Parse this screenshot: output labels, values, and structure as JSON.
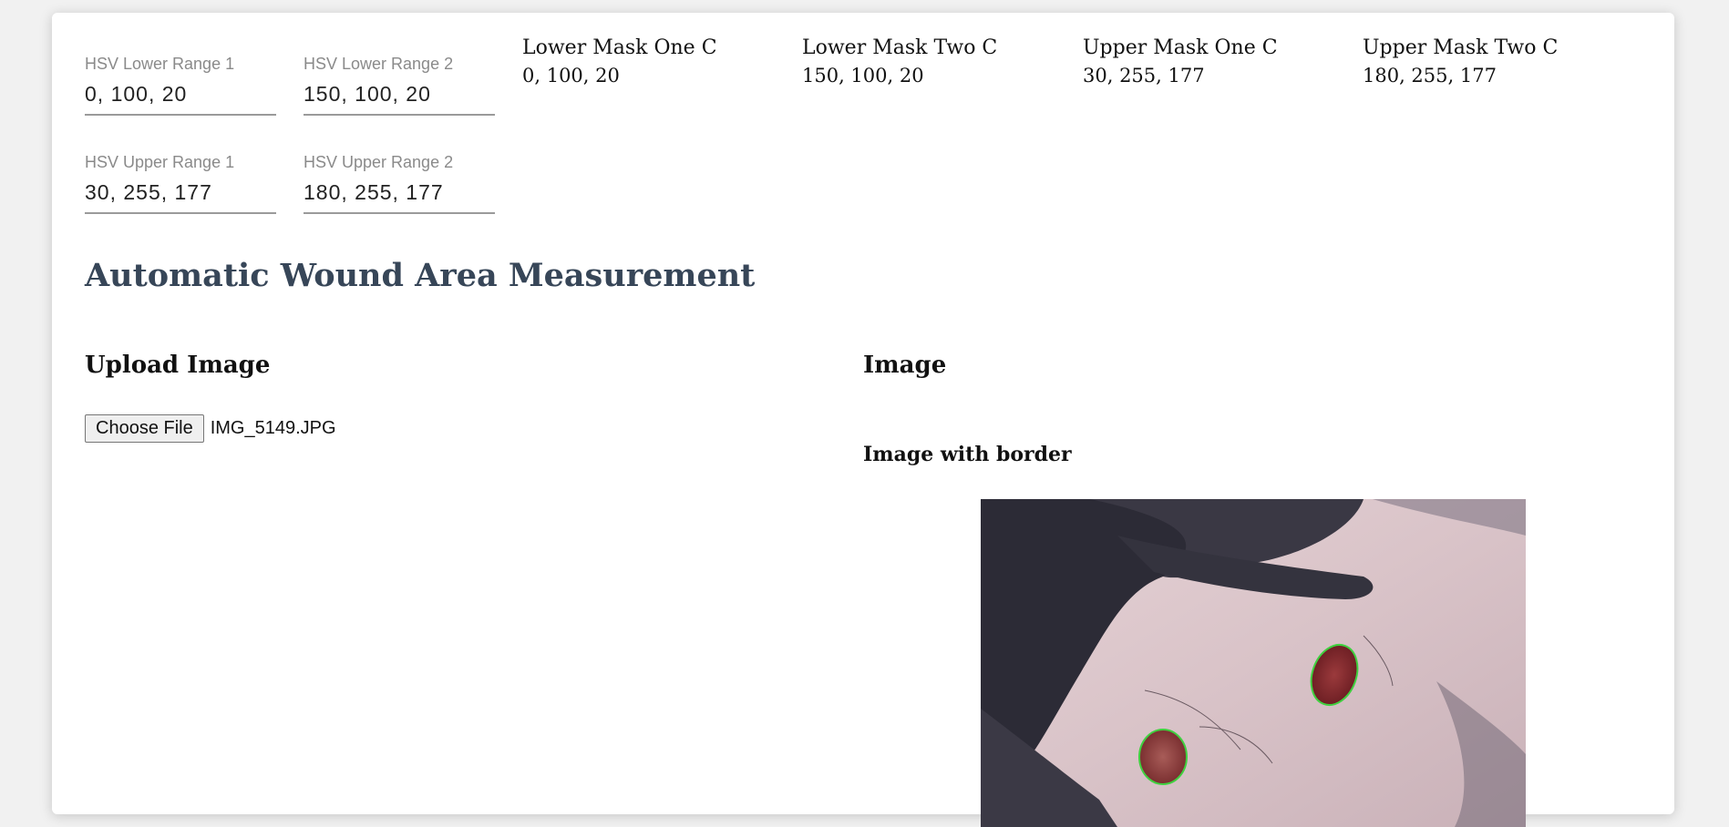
{
  "hsv_inputs": {
    "lower1": {
      "label": "HSV Lower Range 1",
      "value": "0, 100, 20"
    },
    "lower2": {
      "label": "HSV Lower Range 2",
      "value": "150, 100, 20"
    },
    "upper1": {
      "label": "HSV Upper Range 1",
      "value": "30, 255, 177"
    },
    "upper2": {
      "label": "HSV Upper Range 2",
      "value": "180, 255, 177"
    }
  },
  "masks": [
    {
      "title": "Lower Mask One C",
      "value": "0, 100, 20"
    },
    {
      "title": "Lower Mask Two C",
      "value": "150, 100, 20"
    },
    {
      "title": "Upper Mask One C",
      "value": "30, 255, 177"
    },
    {
      "title": "Upper Mask Two C",
      "value": "180, 255, 177"
    }
  ],
  "page_title": "Automatic Wound Area Measurement",
  "upload": {
    "heading": "Upload Image",
    "button_label": "Choose File",
    "file_name": "IMG_5149.JPG"
  },
  "image_panel": {
    "heading": "Image",
    "subheading": "Image with border"
  },
  "colors": {
    "title": "#374658",
    "card_bg": "#ffffff",
    "page_bg": "#f1f1f1",
    "wound_border": "#3fd13f"
  }
}
